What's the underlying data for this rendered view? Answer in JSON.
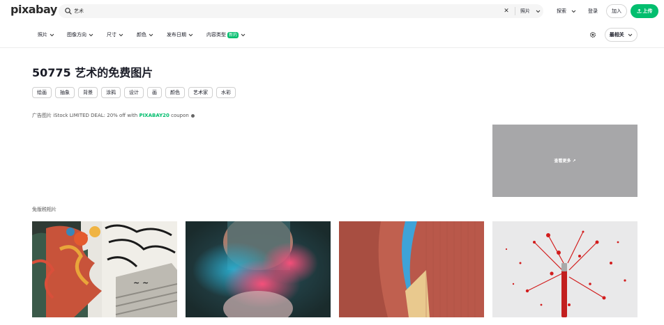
{
  "header": {
    "logo": "pixabay",
    "search": {
      "value": "艺术",
      "placeholder": ""
    },
    "search_type": "照片",
    "explore": "探索",
    "login": "登录",
    "join": "加入",
    "upload": "上传"
  },
  "filters": {
    "items": [
      "照片",
      "图像方向",
      "尺寸",
      "颜色",
      "发布日期",
      "内容类型"
    ],
    "new_badge": "新的",
    "sort": "最相关"
  },
  "main": {
    "title": "50775 艺术的免费图片",
    "tags": [
      "绘画",
      "抽象",
      "背景",
      "涂鸦",
      "设计",
      "画",
      "颜色",
      "艺术家",
      "水彩"
    ],
    "ad": {
      "prefix": "广告图片 iStock LIMITED DEAL: 20% off with ",
      "coupon": "PIXABAY20",
      "suffix": " coupon",
      "box_label": "查看更多 ↗"
    },
    "section_label": "免版税相片"
  },
  "colors": {
    "accent": "#02be6e",
    "text": "#191b26"
  },
  "icons": [
    "search-icon",
    "close-icon",
    "chevron-down-icon",
    "upload-icon",
    "gear-icon",
    "info-icon"
  ]
}
